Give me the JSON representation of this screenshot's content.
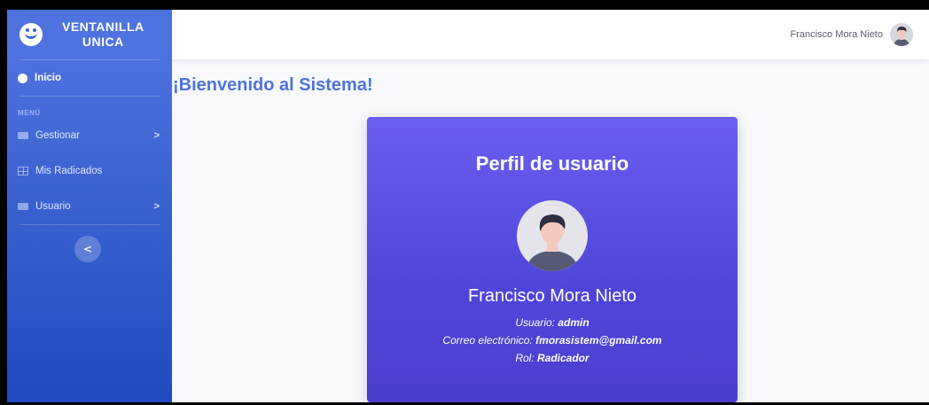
{
  "brand": {
    "line1": "VENTANILLA",
    "line2": "UNICA"
  },
  "sidebar": {
    "items": [
      {
        "label": "Inicio"
      },
      {
        "label": "Gestionar"
      },
      {
        "label": "Mis Radicados"
      },
      {
        "label": "Usuario"
      }
    ],
    "heading": "MENÚ",
    "toggle_icon": "chevron-left"
  },
  "topbar": {
    "user_name": "Francisco Mora Nieto"
  },
  "main": {
    "title": "¡Bienvenido al Sistema!"
  },
  "card": {
    "title": "Perfil de usuario",
    "name": "Francisco Mora Nieto",
    "username_label": "Usuario:",
    "username": "admin",
    "email_label": "Correo electrónico:",
    "email": "fmorasistem@gmail.com",
    "role_label": "Rol:",
    "role": "Radicador"
  },
  "colors": {
    "primary": "#4e73df",
    "card": "#5a50e3"
  }
}
